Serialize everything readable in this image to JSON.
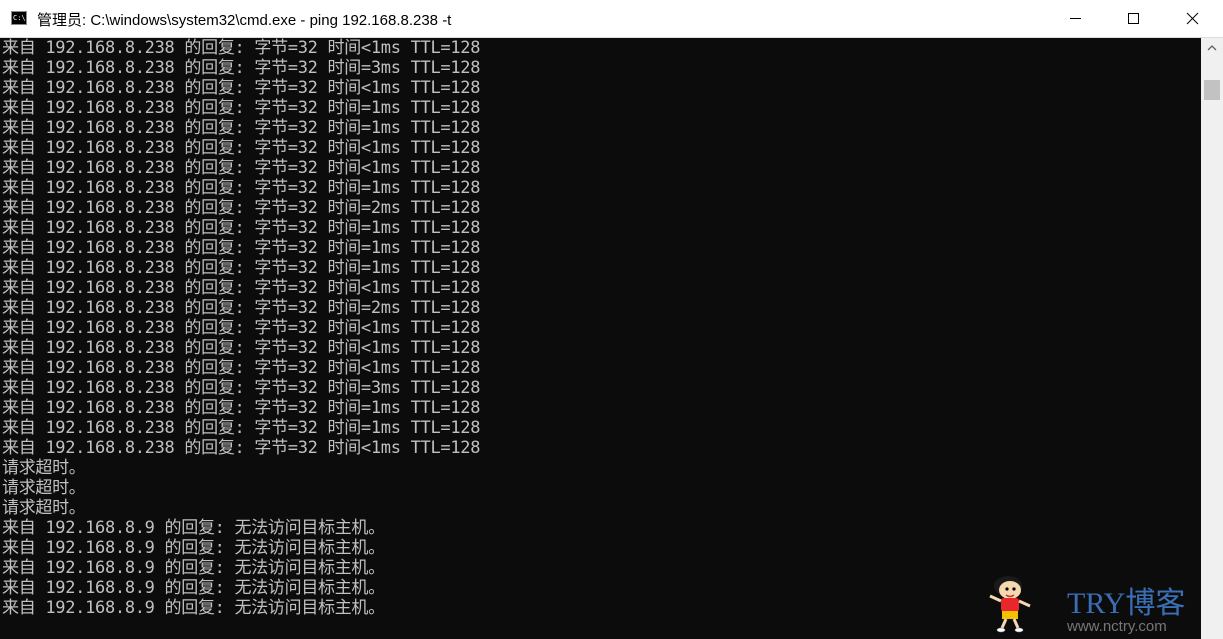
{
  "window": {
    "title": "管理员: C:\\windows\\system32\\cmd.exe - ping  192.168.8.238 -t",
    "icon_label": "C:\\",
    "buttons": [
      "minimize-icon",
      "maximize-icon",
      "close-icon"
    ]
  },
  "console": {
    "foreground": "#c0c0c0",
    "background": "#0c0c0c",
    "lines": [
      "来自 192.168.8.238 的回复: 字节=32 时间<1ms TTL=128",
      "来自 192.168.8.238 的回复: 字节=32 时间=3ms TTL=128",
      "来自 192.168.8.238 的回复: 字节=32 时间<1ms TTL=128",
      "来自 192.168.8.238 的回复: 字节=32 时间=1ms TTL=128",
      "来自 192.168.8.238 的回复: 字节=32 时间=1ms TTL=128",
      "来自 192.168.8.238 的回复: 字节=32 时间<1ms TTL=128",
      "来自 192.168.8.238 的回复: 字节=32 时间<1ms TTL=128",
      "来自 192.168.8.238 的回复: 字节=32 时间=1ms TTL=128",
      "来自 192.168.8.238 的回复: 字节=32 时间=2ms TTL=128",
      "来自 192.168.8.238 的回复: 字节=32 时间=1ms TTL=128",
      "来自 192.168.8.238 的回复: 字节=32 时间=1ms TTL=128",
      "来自 192.168.8.238 的回复: 字节=32 时间=1ms TTL=128",
      "来自 192.168.8.238 的回复: 字节=32 时间<1ms TTL=128",
      "来自 192.168.8.238 的回复: 字节=32 时间=2ms TTL=128",
      "来自 192.168.8.238 的回复: 字节=32 时间<1ms TTL=128",
      "来自 192.168.8.238 的回复: 字节=32 时间<1ms TTL=128",
      "来自 192.168.8.238 的回复: 字节=32 时间<1ms TTL=128",
      "来自 192.168.8.238 的回复: 字节=32 时间=3ms TTL=128",
      "来自 192.168.8.238 的回复: 字节=32 时间=1ms TTL=128",
      "来自 192.168.8.238 的回复: 字节=32 时间=1ms TTL=128",
      "来自 192.168.8.238 的回复: 字节=32 时间<1ms TTL=128",
      "请求超时。",
      "请求超时。",
      "请求超时。",
      "来自 192.168.8.9 的回复: 无法访问目标主机。",
      "来自 192.168.8.9 的回复: 无法访问目标主机。",
      "来自 192.168.8.9 的回复: 无法访问目标主机。",
      "来自 192.168.8.9 的回复: 无法访问目标主机。",
      "来自 192.168.8.9 的回复: 无法访问目标主机。"
    ]
  },
  "watermark": {
    "brand": "TRY博客",
    "url": "www.nctry.com",
    "icon": "cartoon-mascot-icon"
  }
}
